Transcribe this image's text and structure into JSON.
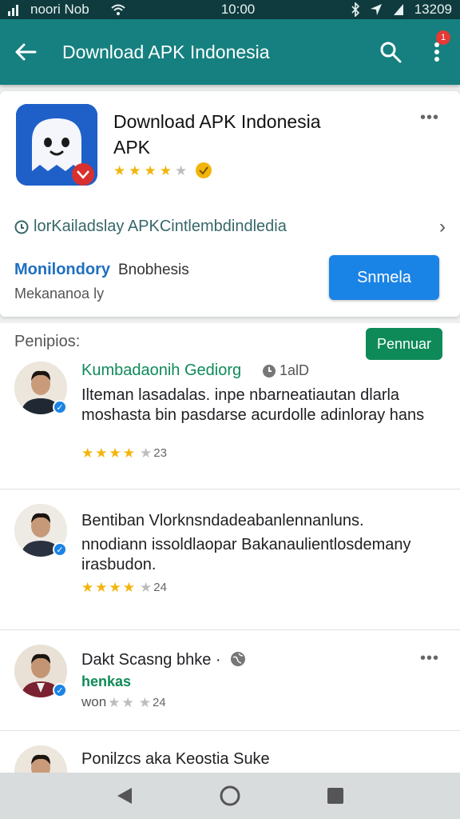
{
  "status_bar": {
    "carrier": "noori Nob",
    "time": "10:00",
    "battery": "13209"
  },
  "app_bar": {
    "title": "Download APK Indonesia",
    "notification_count": "1"
  },
  "app_card": {
    "name": "Download APK Indonesia APK",
    "rating_stars": 4,
    "info_text": "lorKailadslay APKCintlembdindledia",
    "developer_name": "Monilondory",
    "developer_tag": "Bnobhesis",
    "developer_sub": "Mekananoa ly",
    "install_label": "Snmela"
  },
  "reviews": {
    "header": "Penipios:",
    "action_label": "Pennuar",
    "items": [
      {
        "name": "Kumbadaonih Gediorg",
        "meta": "1alD",
        "text": "Ilteman lasadalas. inpe nbarneatiautan dlarla moshasta bin pasdarse acurdolle adinloray hans",
        "stars": 4,
        "count": "23"
      },
      {
        "name": "Bentiban Vlorknsndadeabanlennanluns.",
        "text": "nnodiann issoldlaopar Bakanaulientlosdemany irasbudon.",
        "stars": 4,
        "count": "24"
      },
      {
        "name": "Dakt Scasng bhke ·",
        "sub": "henkas",
        "stars_prefix": "won",
        "count": "24"
      },
      {
        "name": "Ponilzcs aka Keostia Suke"
      }
    ]
  },
  "colors": {
    "app_bar": "#15807f",
    "status_bar": "#0f3b3e",
    "install_button": "#1a83e6",
    "review_button": "#0e8a58",
    "star": "#f3b50b"
  },
  "icons": [
    "back-arrow-icon",
    "search-icon",
    "more-vert-icon",
    "wifi-icon",
    "signal-icon",
    "bluetooth-icon",
    "location-icon",
    "info-icon",
    "chevron-right-icon",
    "globe-icon",
    "nav-back-icon",
    "nav-home-icon",
    "nav-recents-icon"
  ]
}
